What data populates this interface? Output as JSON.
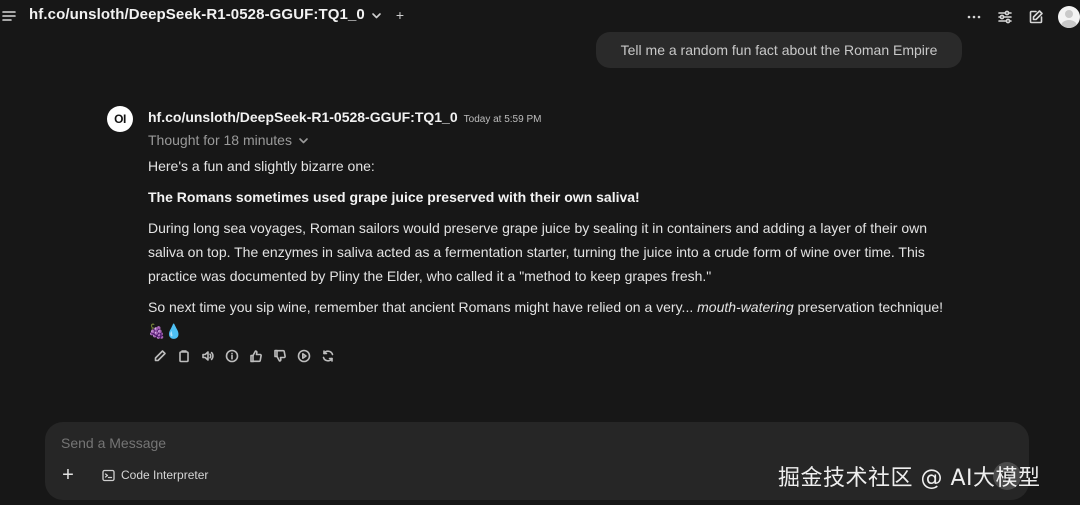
{
  "topbar": {
    "model_name": "hf.co/unsloth/DeepSeek-R1-0528-GGUF:TQ1_0",
    "add_model_label": "+",
    "icons": [
      "menu-icon",
      "chevron-down-icon",
      "more-horizontal-icon",
      "sliders-icon",
      "edit-icon",
      "user-avatar"
    ]
  },
  "user_message": {
    "text": "Tell me a random fun fact about the Roman Empire"
  },
  "assistant": {
    "avatar_text": "OI",
    "name": "hf.co/unsloth/DeepSeek-R1-0528-GGUF:TQ1_0",
    "timestamp": "Today at 5:59 PM",
    "thought_label": "Thought for 18 minutes",
    "paragraphs": {
      "intro": "Here's a fun and slightly bizarre one:",
      "headline": "The Romans sometimes used grape juice preserved with their own saliva!",
      "body": "During long sea voyages, Roman sailors would preserve grape juice by sealing it in containers and adding a layer of their own saliva on top. The enzymes in saliva acted as a fermentation starter, turning the juice into a crude form of wine over time. This practice was documented by Pliny the Elder, who called it a \"method to keep grapes fresh.\"",
      "closing_before": "So next time you sip wine, remember that ancient Romans might have relied on a very... ",
      "closing_em": "mouth-watering",
      "closing_after": " preservation technique! 🍇💧"
    },
    "actions": [
      "edit-icon",
      "copy-icon",
      "speaker-icon",
      "info-icon",
      "thumbs-up-icon",
      "thumbs-down-icon",
      "play-icon",
      "regenerate-icon"
    ]
  },
  "composer": {
    "placeholder": "Send a Message",
    "plus_label": "+",
    "code_interpreter_label": "Code Interpreter"
  },
  "watermark": "掘金技术社区 @ AI大模型",
  "colors": {
    "background": "#171717",
    "bubble": "#2a2a2a",
    "composer": "#262626"
  }
}
